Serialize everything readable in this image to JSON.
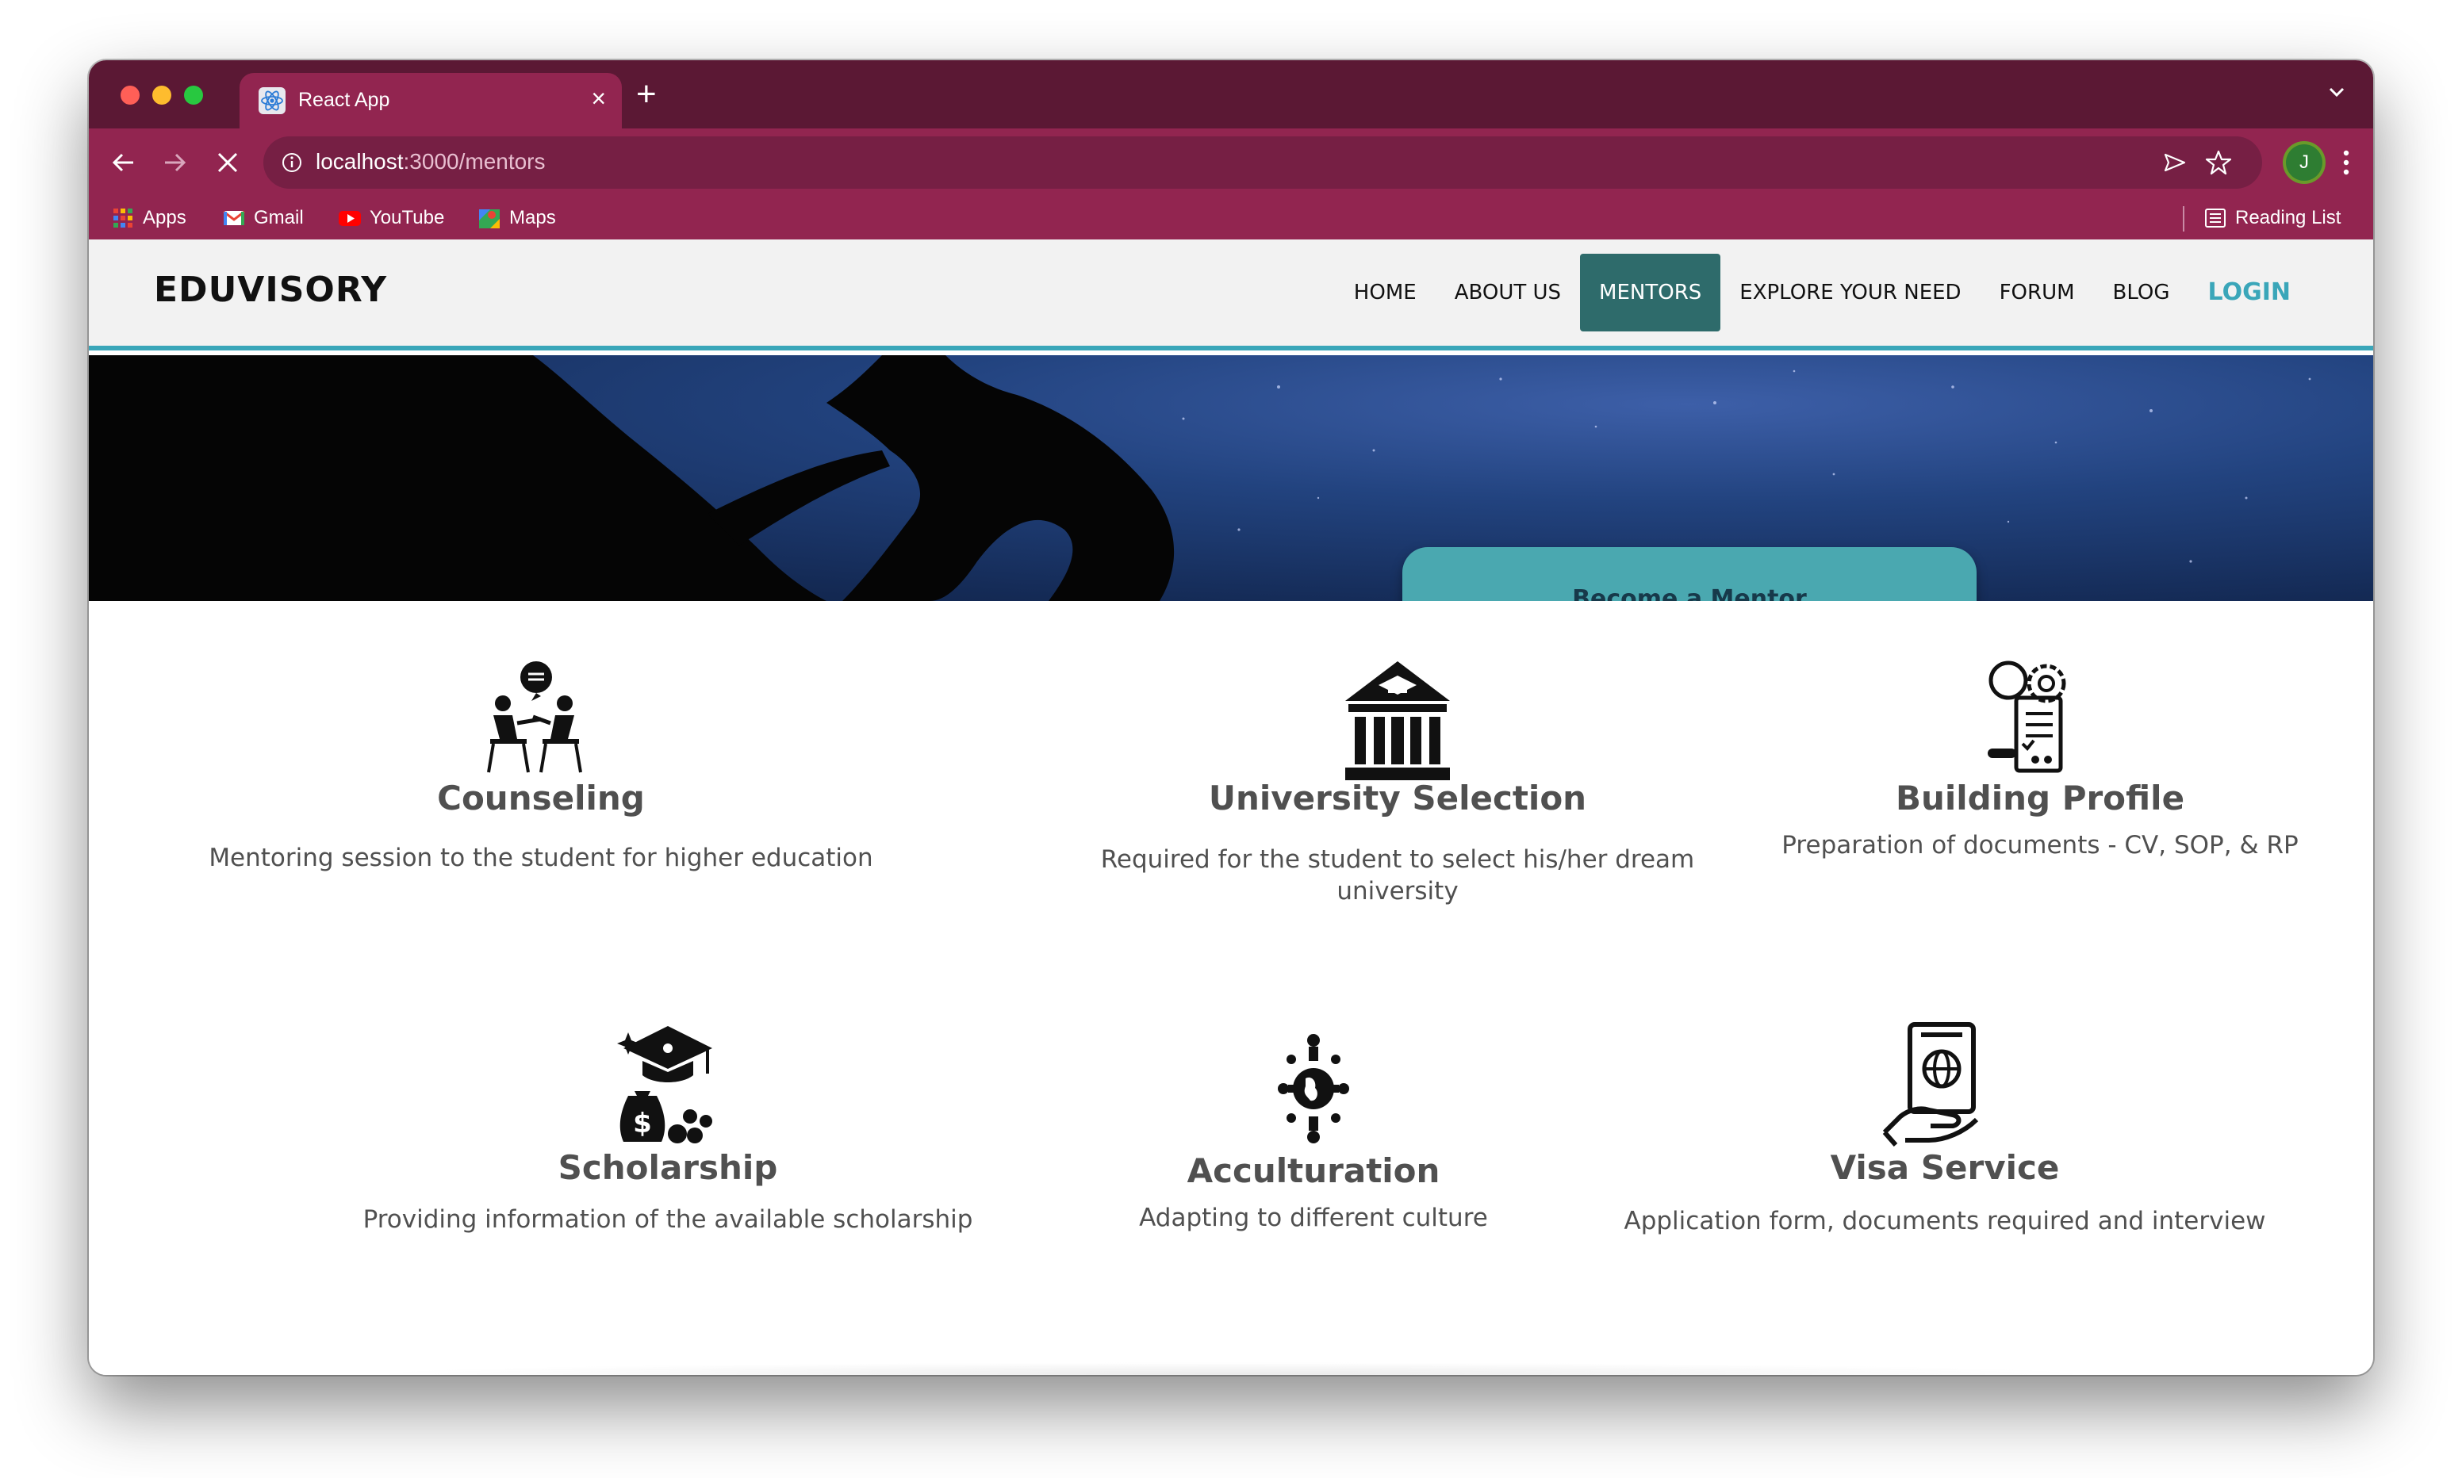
{
  "browser": {
    "tab_title": "React App",
    "url_host": "localhost",
    "url_path": ":3000/mentors",
    "avatar_letter": "J",
    "bookmarks": [
      {
        "label": "Apps",
        "icon": "apps-grid-icon"
      },
      {
        "label": "Gmail",
        "icon": "gmail-icon"
      },
      {
        "label": "YouTube",
        "icon": "youtube-icon"
      },
      {
        "label": "Maps",
        "icon": "maps-icon"
      }
    ],
    "reading_list": "Reading List"
  },
  "site": {
    "brand": "EDUVISORY",
    "nav": [
      {
        "label": "HOME"
      },
      {
        "label": "ABOUT US"
      },
      {
        "label": "MENTORS",
        "active": true
      },
      {
        "label": "EXPLORE YOUR NEED"
      },
      {
        "label": "FORUM"
      },
      {
        "label": "BLOG"
      },
      {
        "label": "LOGIN"
      }
    ],
    "hero_button": "Become a Mentor"
  },
  "services": [
    {
      "title": "Counseling",
      "desc": "Mentoring session to the student for higher education",
      "icon": "counseling-icon"
    },
    {
      "title": "University Selection",
      "desc": "Required for the student to select his/her dream university",
      "icon": "university-icon"
    },
    {
      "title": "Building Profile",
      "desc": "Preparation of documents - CV, SOP, & RP",
      "icon": "profile-building-icon"
    },
    {
      "title": "Scholarship",
      "desc": "Providing information of the available scholarship",
      "icon": "scholarship-icon"
    },
    {
      "title": "Acculturation",
      "desc": "Adapting to different culture",
      "icon": "acculturation-icon"
    },
    {
      "title": "Visa Service",
      "desc": "Application form, documents required and interview",
      "icon": "visa-icon"
    }
  ],
  "colors": {
    "tabstrip": "#5b1834",
    "toolbar": "#922550",
    "accent": "#3aa6b9",
    "active_nav": "#2e6b6b",
    "hero_button": "#4aa8b0"
  }
}
